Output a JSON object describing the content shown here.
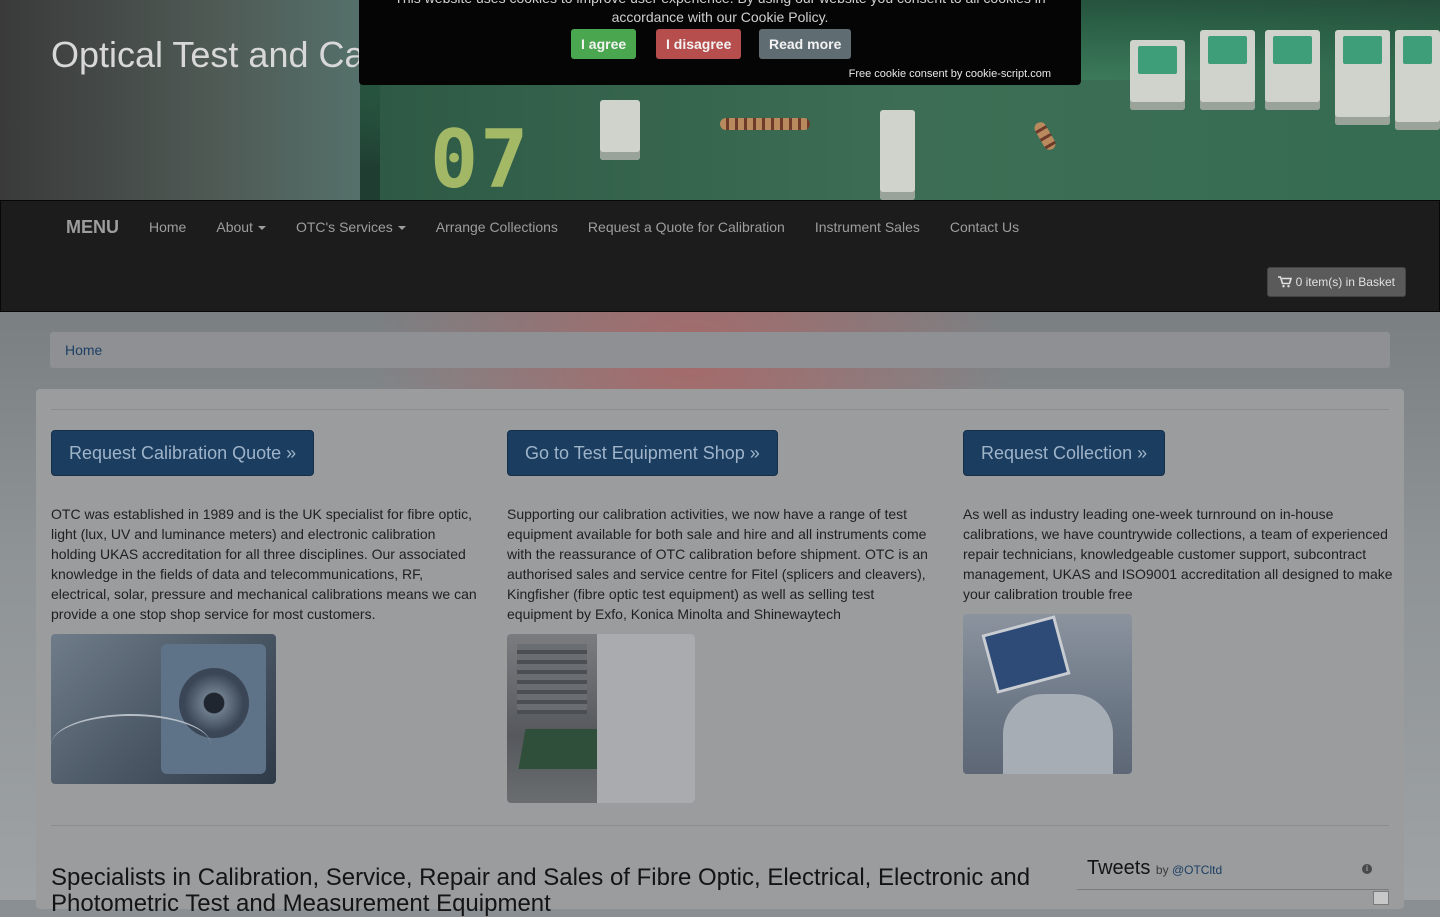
{
  "header": {
    "site_title": "Optical Test and Ca"
  },
  "cookie_bar": {
    "message": "This website uses cookies to improve user experience. By using our website you consent to all cookies in accordance with our Cookie Policy.",
    "agree_label": "I agree",
    "disagree_label": "I disagree",
    "read_more_label": "Read more",
    "credit_prefix": "Free cookie consent by ",
    "credit_link": "cookie-script.com",
    "colors": {
      "agree": "#4aa74f",
      "disagree": "#b74e4e",
      "read_more": "#5f6c72"
    }
  },
  "navbar": {
    "brand": "MENU",
    "items": [
      {
        "label": "Home",
        "dropdown": false
      },
      {
        "label": "About",
        "dropdown": true
      },
      {
        "label": "OTC's Services",
        "dropdown": true
      },
      {
        "label": "Arrange Collections",
        "dropdown": false
      },
      {
        "label": "Request a Quote for Calibration",
        "dropdown": false
      },
      {
        "label": "Instrument Sales",
        "dropdown": false
      },
      {
        "label": "Contact Us",
        "dropdown": false
      }
    ],
    "basket": {
      "icon": "shopping-cart-icon",
      "label": "0 item(s) in Basket"
    }
  },
  "breadcrumb": {
    "home": "Home"
  },
  "columns": [
    {
      "button": "Request Calibration Quote »",
      "text": "OTC was established in 1989 and is the UK specialist for fibre optic, light (lux, UV and luminance meters) and electronic calibration holding UKAS accreditation for all three disciplines. Our associated knowledge in the fields of data and telecommunications, RF, electrical, solar, pressure and mechanical calibrations means we can provide a one stop shop service for most customers."
    },
    {
      "button": "Go to Test Equipment Shop »",
      "text": "Supporting our calibration activities, we now have a range of test equipment available for both sale and hire and all instruments come with the reassurance of OTC calibration before shipment. OTC is an authorised sales and service centre for Fitel (splicers and cleavers), Kingfisher (fibre optic test equipment) as well as selling test equipment by Exfo, Konica Minolta and Shinewaytech"
    },
    {
      "button": "Request Collection »",
      "text": "As well as industry leading one-week turnround on in-house calibrations, we have countrywide collections, a team of experienced repair technicians, knowledgeable customer support, subcontract management, UKAS and ISO9001 accreditation all designed to make your calibration trouble free"
    }
  ],
  "main": {
    "headline": "Specialists in Calibration, Service, Repair and Sales of Fibre Optic, Electrical, Electronic and Photometric Test and Measurement Equipment"
  },
  "tweets": {
    "title": "Tweets",
    "by": "by ",
    "handle": "@OTCltd",
    "info_icon": "i"
  },
  "colors": {
    "navbar_bg": "#1c1c1c",
    "primary_button": "#1b3e60",
    "link": "#1d3f63"
  }
}
